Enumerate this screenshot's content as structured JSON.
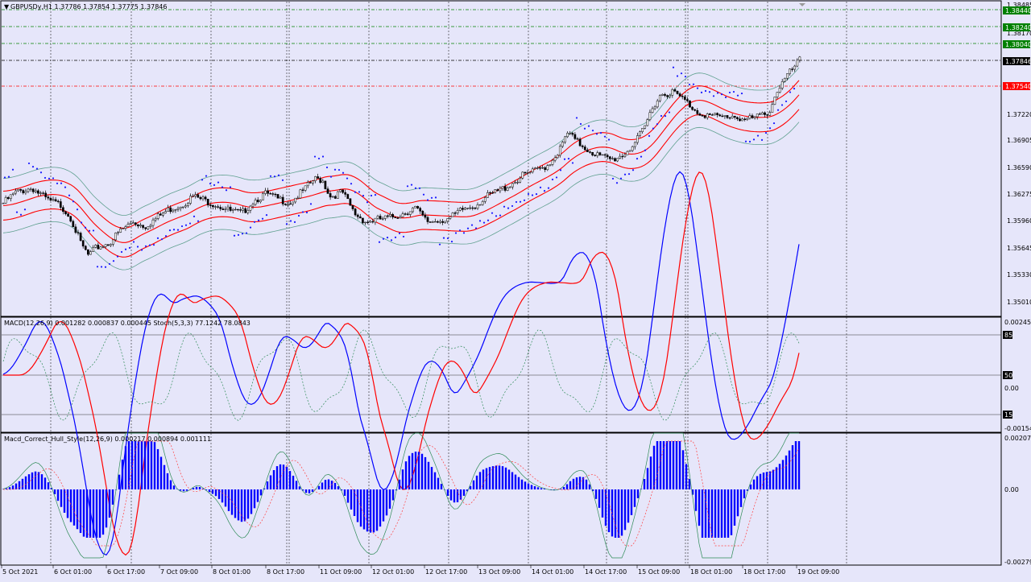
{
  "symbol_header": "GBPUSDy,H1  1.37786 1.37854 1.37775 1.37846",
  "indicator1_header": "MACD(12,26,9) 0.001282 0.000837 0.000445  Stoch(5,3,3) 77.1242 78.0843",
  "indicator2_header": "Macd_Correct_Hull_Style(12,26,9) 0.000217 0.000894 0.001111",
  "colors": {
    "background": "#e6e6fa",
    "bullish_candle": "#ffffff",
    "bearish_candle": "#000000",
    "bollinger": "#5fa08f",
    "envelope": "#ff0000",
    "sar": "#1a1aff",
    "macd_main": "#0000ff",
    "macd_signal": "#ff0000",
    "stoch": "#2e8b57",
    "histogram": "#0000ff"
  },
  "main_axis": [
    "1.38485",
    "1.38170",
    "1.37220",
    "1.36905",
    "1.36590",
    "1.36275",
    "1.35960",
    "1.35645",
    "1.35330",
    "1.35010"
  ],
  "price_labels": [
    {
      "value": "1.38440",
      "color": "#008000"
    },
    {
      "value": "1.38240",
      "color": "#008000"
    },
    {
      "value": "1.38040",
      "color": "#008000"
    },
    {
      "value": "1.37846",
      "color": "#000000"
    },
    {
      "value": "1.37540",
      "color": "#ff0000"
    }
  ],
  "macd_axis": {
    "top": "0.002451",
    "levels": [
      "85",
      "50",
      "15"
    ],
    "mid": "0.00",
    "bottom": "-0.00154"
  },
  "hull_axis": {
    "top": "0.002074",
    "mid": "0.00",
    "bottom": "-0.002793"
  },
  "time_labels": [
    "5 Oct 2021",
    "6 Oct 01:00",
    "6 Oct 17:00",
    "7 Oct 09:00",
    "8 Oct 01:00",
    "8 Oct 17:00",
    "11 Oct 09:00",
    "12 Oct 01:00",
    "12 Oct 17:00",
    "13 Oct 09:00",
    "14 Oct 01:00",
    "14 Oct 17:00",
    "15 Oct 09:00",
    "18 Oct 01:00",
    "18 Oct 17:00",
    "19 Oct 09:00"
  ],
  "chart_data": {
    "type": "candlestick",
    "symbol": "GBPUSDy",
    "timeframe": "H1",
    "ohlc_last": {
      "open": 1.37786,
      "high": 1.37854,
      "low": 1.37775,
      "close": 1.37846
    },
    "ylim": [
      1.3501,
      1.38485
    ],
    "close_path": [
      [
        0,
        1.3614
      ],
      [
        20,
        1.363
      ],
      [
        40,
        1.3635
      ],
      [
        60,
        1.362
      ],
      [
        75,
        1.3615
      ],
      [
        88,
        1.36
      ],
      [
        100,
        1.357
      ],
      [
        110,
        1.3555
      ],
      [
        120,
        1.3565
      ],
      [
        135,
        1.357
      ],
      [
        150,
        1.3585
      ],
      [
        165,
        1.3595
      ],
      [
        180,
        1.359
      ],
      [
        195,
        1.36
      ],
      [
        210,
        1.361
      ],
      [
        225,
        1.3615
      ],
      [
        240,
        1.3625
      ],
      [
        255,
        1.362
      ],
      [
        270,
        1.3615
      ],
      [
        285,
        1.3608
      ],
      [
        300,
        1.3605
      ],
      [
        315,
        1.362
      ],
      [
        330,
        1.3628
      ],
      [
        345,
        1.3622
      ],
      [
        360,
        1.3618
      ],
      [
        375,
        1.363
      ],
      [
        390,
        1.3645
      ],
      [
        400,
        1.3645
      ],
      [
        410,
        1.3625
      ],
      [
        425,
        1.363
      ],
      [
        440,
        1.3605
      ],
      [
        455,
        1.3595
      ],
      [
        470,
        1.3598
      ],
      [
        485,
        1.36
      ],
      [
        500,
        1.3605
      ],
      [
        515,
        1.3612
      ],
      [
        530,
        1.3595
      ],
      [
        545,
        1.3597
      ],
      [
        560,
        1.36
      ],
      [
        575,
        1.361
      ],
      [
        590,
        1.3615
      ],
      [
        605,
        1.3625
      ],
      [
        620,
        1.3632
      ],
      [
        635,
        1.364
      ],
      [
        650,
        1.365
      ],
      [
        665,
        1.3655
      ],
      [
        680,
        1.3662
      ],
      [
        695,
        1.368
      ],
      [
        705,
        1.37
      ],
      [
        715,
        1.369
      ],
      [
        730,
        1.368
      ],
      [
        745,
        1.3672
      ],
      [
        760,
        1.3668
      ],
      [
        775,
        1.3675
      ],
      [
        790,
        1.369
      ],
      [
        800,
        1.3705
      ],
      [
        810,
        1.373
      ],
      [
        820,
        1.3745
      ],
      [
        835,
        1.3748
      ],
      [
        850,
        1.3738
      ],
      [
        865,
        1.3725
      ],
      [
        880,
        1.372
      ],
      [
        895,
        1.3718
      ],
      [
        910,
        1.372
      ],
      [
        925,
        1.3715
      ],
      [
        940,
        1.3718
      ],
      [
        955,
        1.3725
      ],
      [
        965,
        1.375
      ],
      [
        980,
        1.377
      ],
      [
        993,
        1.3785
      ]
    ],
    "indicators": {
      "bollinger_bands": "Bollinger(20)",
      "envelopes": "Envelopes",
      "parabolic_sar": "SAR"
    },
    "macd": {
      "params": "12,26,9",
      "main": 0.001282,
      "signal": 0.000837,
      "histogram": 0.000445
    },
    "stochastic": {
      "params": "5,3,3",
      "k": 77.1242,
      "d": 78.0843,
      "levels": [
        15,
        50,
        85
      ]
    },
    "macd_hull": {
      "params": "12,26,9",
      "values": [
        0.000217,
        0.000894,
        0.001111
      ]
    }
  }
}
